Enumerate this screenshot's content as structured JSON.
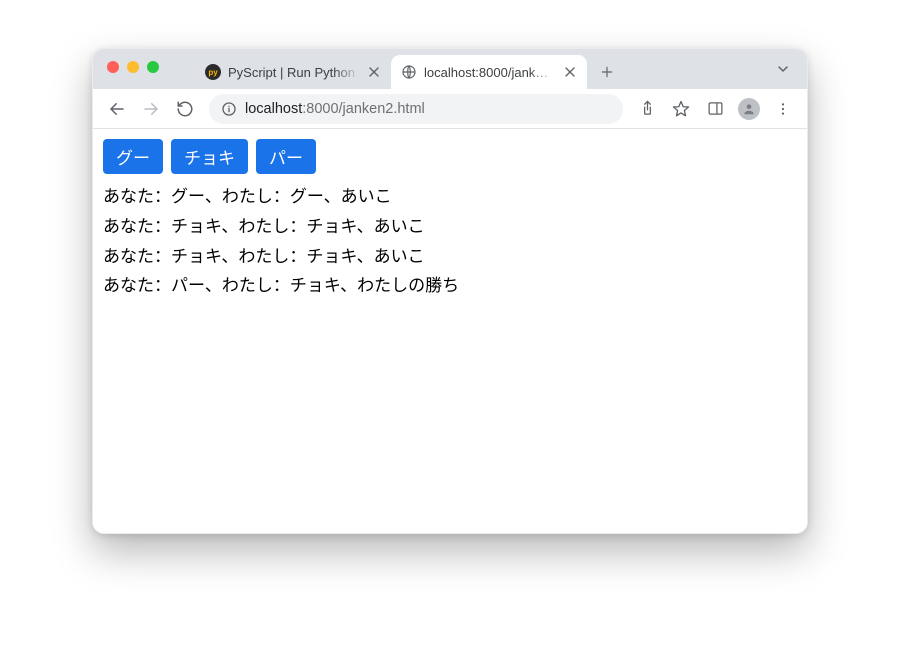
{
  "tabs": [
    {
      "title": "PyScript | Run Python …",
      "active": false
    },
    {
      "title": "localhost:8000/jank…",
      "active": true
    }
  ],
  "toolbar": {
    "url_host_strong": "localhost",
    "url_host_rest": ":8000/janken2.html"
  },
  "buttons": {
    "rock": "グー",
    "scissors": "チョキ",
    "paper": "パー"
  },
  "results": [
    "あなた：グー、わたし：グー、あいこ",
    "あなた：チョキ、わたし：チョキ、あいこ",
    "あなた：チョキ、わたし：チョキ、あいこ",
    "あなた：パー、わたし：チョキ、わたしの勝ち"
  ]
}
